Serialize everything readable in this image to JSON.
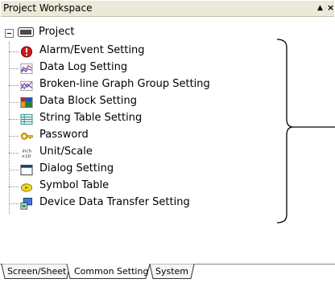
{
  "window": {
    "title": "Project Workspace",
    "pin_glyph": "▲",
    "close_glyph": "×"
  },
  "tree": {
    "root": {
      "label": "Project",
      "icon": "project-icon"
    },
    "items": [
      {
        "label": "Alarm/Event Setting",
        "icon": "alarm-icon"
      },
      {
        "label": "Data Log Setting",
        "icon": "data-log-icon"
      },
      {
        "label": "Broken-line Graph Group Setting",
        "icon": "broken-line-graph-icon"
      },
      {
        "label": "Data Block Setting",
        "icon": "data-block-icon"
      },
      {
        "label": "String Table Setting",
        "icon": "string-table-icon"
      },
      {
        "label": "Password",
        "icon": "key-icon"
      },
      {
        "label": "Unit/Scale",
        "icon": "unit-scale-icon"
      },
      {
        "label": "Dialog Setting",
        "icon": "dialog-icon"
      },
      {
        "label": "Symbol Table",
        "icon": "symbol-table-icon"
      },
      {
        "label": "Device Data Transfer Setting",
        "icon": "device-transfer-icon"
      }
    ]
  },
  "tabs": [
    {
      "label": "Screen/Sheet"
    },
    {
      "label": "Common Setting"
    },
    {
      "label": "System"
    }
  ],
  "colors": {
    "titlebar_bg": "#ece9d8",
    "tab_bg": "#f5f5f5",
    "tree_line": "#8a8a8a"
  },
  "icons": {
    "tabs_icon_hint": "bracket-annotation"
  }
}
